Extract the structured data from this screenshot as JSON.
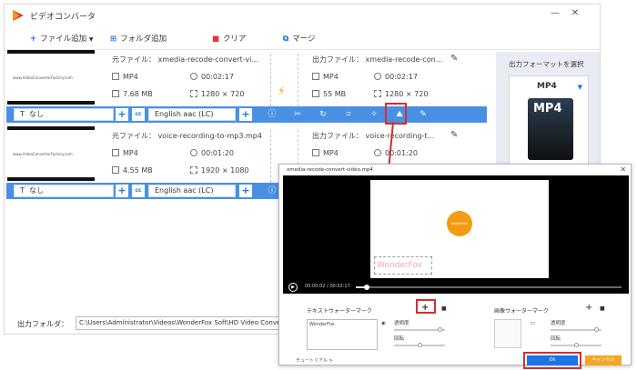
{
  "app": {
    "title": "ビデオコンバータ"
  },
  "toolbar": {
    "add_file": "ファイル追加",
    "add_folder": "フォルダ追加",
    "clear": "クリア",
    "merge": "マージ"
  },
  "files": [
    {
      "thumb_text": "www.VideoConverterFactory.com",
      "source_label": "元ファイル：",
      "source_name": "xmedia-recode-convert-vi...",
      "format": "MP4",
      "duration": "00:02:17",
      "size": "7.68 MB",
      "resolution": "1280 × 720",
      "output_label": "出力ファイル：",
      "output_name": "xmedia-recode-con...",
      "out_format": "MP4",
      "out_duration": "00:02:17",
      "out_size": "55 MB",
      "out_resolution": "1280 × 720"
    },
    {
      "thumb_text": "www.VideoConverterFactory.com",
      "source_label": "元ファイル：",
      "source_name": "voice-recording-to-mp3.mp4",
      "format": "MP4",
      "duration": "00:01:20",
      "size": "4.55 MB",
      "resolution": "1920 × 1080",
      "output_label": "出力ファイル：",
      "output_name": "voice-recording-t...",
      "out_format": "MP4",
      "out_duration": "00:01:20",
      "out_size": "",
      "out_resolution": ""
    }
  ],
  "row_toolbar": {
    "subtitle": "なし",
    "audio": "English aac (LC)"
  },
  "format_panel": {
    "label": "出力フォーマットを選択",
    "selected": "MP4",
    "card_text": "MP4"
  },
  "output": {
    "label": "出力フォルダ：",
    "path": "C:\\Users\\Administrator\\Videos\\WonderFox Soft\\HD Video Converter Factory\\Output\\"
  },
  "dialog": {
    "title": "xmedia-recode-convert-video.mp4",
    "logo_text": "wonderfox",
    "watermark_text": "WonderFox",
    "time": "00:00:02 / 00:02:17",
    "seek_progress": 0.04,
    "text_wm_label": "テキストウォーターマーク",
    "image_wm_label": "画像ウォーターマーク",
    "text_box_value": "WonderFox",
    "opacity_label": "透明度",
    "rotate_label": "回転",
    "tutorial": "チュートリアル >",
    "ok": "Ok",
    "cancel": "キャンセル"
  },
  "colors": {
    "accent": "#4a90e2",
    "highlight": "#d32f2f",
    "ok": "#1a73e8",
    "cancel": "#f5a623"
  }
}
